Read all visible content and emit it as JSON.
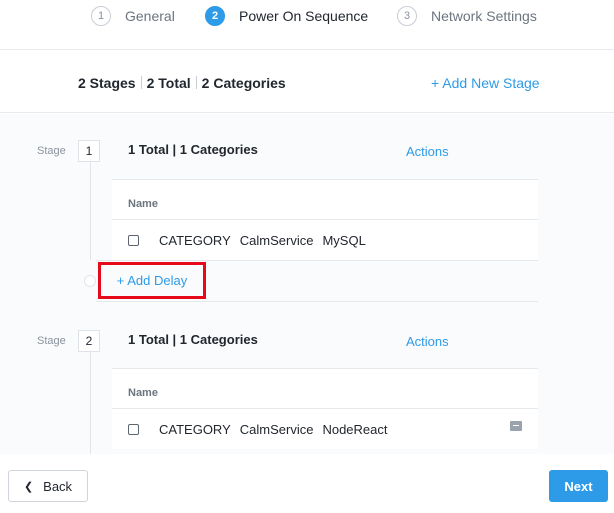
{
  "wizard": {
    "steps": [
      {
        "number": "1",
        "label": "General"
      },
      {
        "number": "2",
        "label": "Power On Sequence"
      },
      {
        "number": "3",
        "label": "Network Settings"
      }
    ]
  },
  "summary": {
    "stages": "2 Stages",
    "total": "2 Total",
    "categories": "2 Categories",
    "add_stage": "+ Add New Stage"
  },
  "stages": [
    {
      "label": "Stage",
      "number": "1",
      "header": "1 Total | 1 Categories",
      "actions": "Actions",
      "column": "Name",
      "entity": {
        "type": "CATEGORY",
        "key": "CalmService",
        "value": "MySQL"
      }
    },
    {
      "label": "Stage",
      "number": "2",
      "header": "1 Total | 1 Categories",
      "actions": "Actions",
      "column": "Name",
      "entity": {
        "type": "CATEGORY",
        "key": "CalmService",
        "value": "NodeReact"
      }
    }
  ],
  "add_delay": "+ Add Delay",
  "footer": {
    "back": "Back",
    "next": "Next"
  },
  "colors": {
    "accent": "#2e9be8",
    "highlight": "#e5091a"
  }
}
